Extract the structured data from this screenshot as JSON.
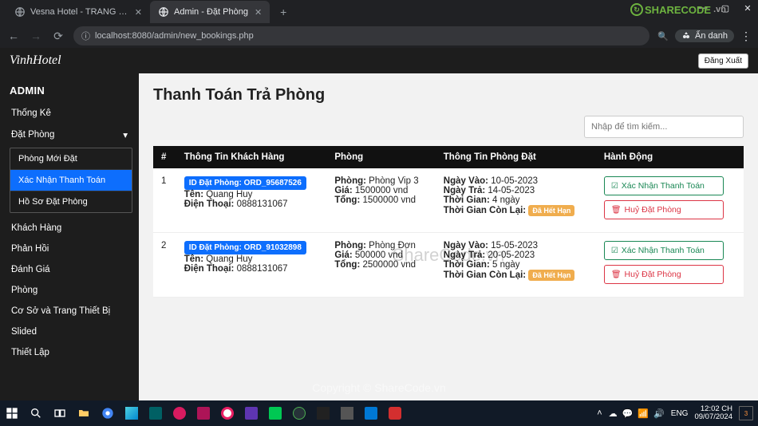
{
  "browser": {
    "tabs": [
      {
        "title": "Vesna Hotel - TRANG CHỦ",
        "active": false
      },
      {
        "title": "Admin - Đặt Phòng",
        "active": true
      }
    ],
    "url": "localhost:8080/admin/new_bookings.php",
    "incognito_label": "Ẩn danh"
  },
  "page": {
    "brand": "VinhHotel",
    "logout_label": "Đăng Xuất",
    "title": "Thanh Toán Trả Phòng",
    "search_placeholder": "Nhập để tìm kiếm..."
  },
  "sidebar": {
    "heading": "ADMIN",
    "items": [
      {
        "label": "Thống Kê"
      },
      {
        "label": "Đặt Phòng",
        "expanded": true,
        "children": [
          {
            "label": "Phòng Mới Đặt"
          },
          {
            "label": "Xác Nhận Thanh Toán",
            "active": true
          },
          {
            "label": "Hồ Sơ Đặt Phòng"
          }
        ]
      },
      {
        "label": "Khách Hàng"
      },
      {
        "label": "Phản Hồi"
      },
      {
        "label": "Đánh Giá"
      },
      {
        "label": "Phòng"
      },
      {
        "label": "Cơ Sở và Trang Thiết Bị"
      },
      {
        "label": "Slided"
      },
      {
        "label": "Thiết Lập"
      }
    ]
  },
  "table": {
    "headers": {
      "idx": "#",
      "customer": "Thông Tin Khách Hàng",
      "room": "Phòng",
      "booking": "Thông Tin Phòng Đặt",
      "action": "Hành Động"
    },
    "labels": {
      "id_prefix": "ID Đặt Phòng:",
      "name": "Tên:",
      "phone": "Điện Thoại:",
      "room": "Phòng:",
      "price": "Giá:",
      "total": "Tổng:",
      "checkin": "Ngày Vào:",
      "checkout": "Ngày Trả:",
      "duration": "Thời Gian:",
      "remain": "Thời Gian Còn Lại:",
      "expired": "Đã Hết Hạn",
      "confirm": "Xác Nhận Thanh Toán",
      "cancel": "Huỷ Đặt Phòng"
    },
    "rows": [
      {
        "idx": "1",
        "order_id": "ORD_95687526",
        "name": "Quang Huy",
        "phone": "0888131067",
        "room": "Phòng Vip 3",
        "price": "1500000 vnd",
        "total": "1500000 vnd",
        "checkin": "10-05-2023",
        "checkout": "14-05-2023",
        "duration": "4 ngày",
        "remain_expired": true
      },
      {
        "idx": "2",
        "order_id": "ORD_91032898",
        "name": "Quang Huy",
        "phone": "0888131067",
        "room": "Phòng Đơn",
        "price": "500000 vnd",
        "total": "2500000 vnd",
        "checkin": "15-05-2023",
        "checkout": "20-05-2023",
        "duration": "5 ngày",
        "remain_expired": true
      }
    ]
  },
  "watermarks": {
    "big": "ShareCode.vn",
    "bottom": "Copyright © ShareCode.vn",
    "logo": "SHARECODE",
    "logo_suffix": ".vn"
  },
  "taskbar": {
    "lang": "ENG",
    "time": "12:02 CH",
    "date": "09/07/2024",
    "notif_count": "3"
  }
}
